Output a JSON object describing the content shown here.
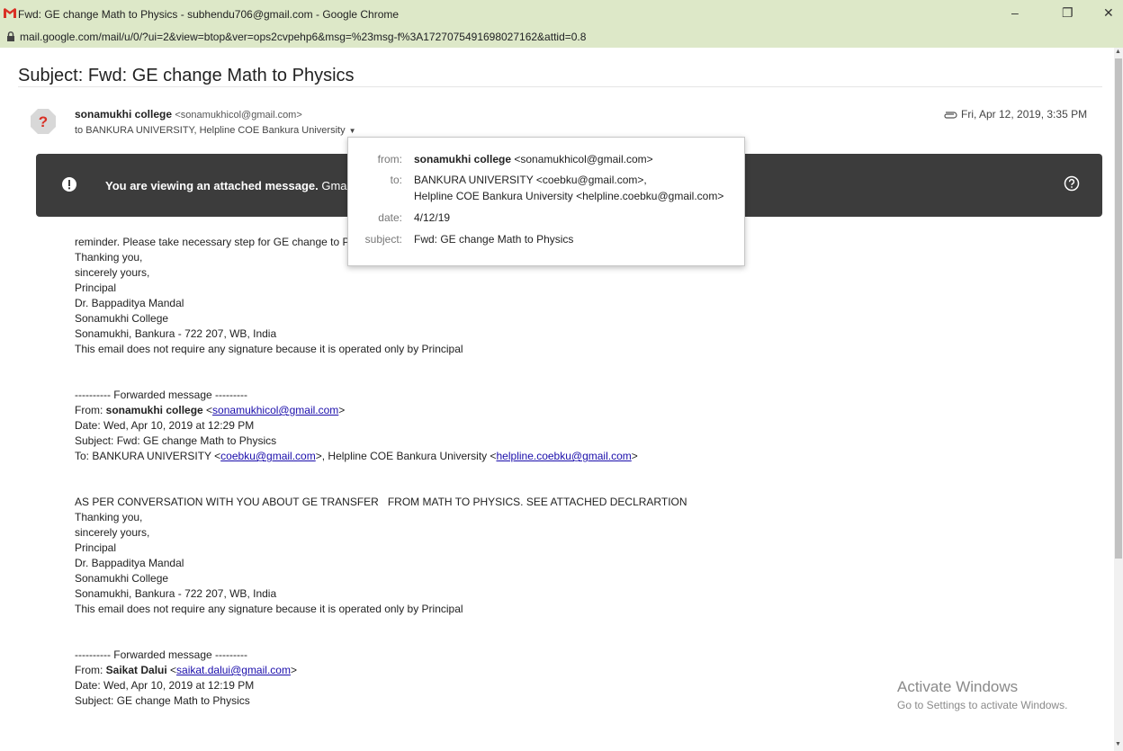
{
  "window": {
    "title": "Fwd: GE change Math to Physics - subhendu706@gmail.com - Google Chrome",
    "url": "mail.google.com/mail/u/0/?ui=2&view=btop&ver=ops2cvpehp6&msg=%23msg-f%3A1727075491698027162&attid=0.8",
    "controls": {
      "minimize": "–",
      "restore": "❐",
      "close": "✕"
    }
  },
  "email": {
    "subject": "Subject: Fwd: GE change Math to Physics",
    "sender_name": "sonamukhi college",
    "sender_email": "<sonamukhicol@gmail.com>",
    "to_line": "to BANKURA UNIVERSITY, Helpline COE Bankura University",
    "date": "Fri, Apr 12, 2019, 3:35 PM"
  },
  "banner": {
    "bold": "You are viewing an attached message.",
    "text": " Gmail c"
  },
  "details_popup": {
    "from_label": "from:",
    "from_name": "sonamukhi college",
    "from_email": "<sonamukhicol@gmail.com>",
    "to_label": "to:",
    "to_line1": "BANKURA UNIVERSITY <coebku@gmail.com>,",
    "to_line2": "Helpline COE Bankura University <helpline.coebku@gmail.com>",
    "date_label": "date:",
    "date_value": "4/12/19",
    "subject_label": "subject:",
    "subject_value": "Fwd: GE change Math to Physics"
  },
  "body": {
    "p1": [
      "reminder. Please take necessary step for GE change to Phys",
      "Thanking you,",
      "sincerely yours,",
      "Principal",
      "Dr. Bappaditya Mandal",
      "Sonamukhi College",
      "Sonamukhi, Bankura - 722 207, WB, India",
      "This email does not require any signature because it is operated only by Principal"
    ],
    "fwd1": {
      "header": "---------- Forwarded message ---------",
      "from_label": "From: ",
      "from_name": "sonamukhi college",
      "from_open": " <",
      "from_email": "sonamukhicol@gmail.com",
      "from_close": ">",
      "date": "Date: Wed, Apr 10, 2019 at 12:29 PM",
      "subject": "Subject: Fwd: GE change Math to Physics",
      "to_prefix": "To: BANKURA UNIVERSITY <",
      "to_email1": "coebku@gmail.com",
      "to_mid": ">, Helpline COE Bankura University <",
      "to_email2": "helpline.coebku@gmail.com",
      "to_close": ">"
    },
    "p2": [
      "AS PER CONVERSATION WITH YOU ABOUT GE TRANSFER   FROM MATH TO PHYSICS. SEE ATTACHED DECLRARTION",
      "Thanking you,",
      "sincerely yours,",
      "Principal",
      "Dr. Bappaditya Mandal",
      "Sonamukhi College",
      "Sonamukhi, Bankura - 722 207, WB, India",
      "This email does not require any signature because it is operated only by Principal"
    ],
    "fwd2": {
      "header": "---------- Forwarded message ---------",
      "from_label": "From: ",
      "from_name": "Saikat Dalui",
      "from_open": " <",
      "from_email": "saikat.dalui@gmail.com",
      "from_close": ">",
      "date": "Date: Wed, Apr 10, 2019 at 12:19 PM",
      "subject": "Subject: GE change Math to Physics"
    }
  },
  "watermark": {
    "line1": "Activate Windows",
    "line2": "Go to Settings to activate Windows."
  },
  "icons": {
    "gmail": "gmail-icon",
    "lock": "lock-icon",
    "avatar": "question-avatar-icon",
    "attachment": "paperclip-icon",
    "alert": "exclamation-icon",
    "help": "help-circle-icon"
  },
  "colors": {
    "chrome": "#dde8c8",
    "banner": "#3c3c3c",
    "avatar": "#d93025",
    "link": "#1a0dab"
  }
}
